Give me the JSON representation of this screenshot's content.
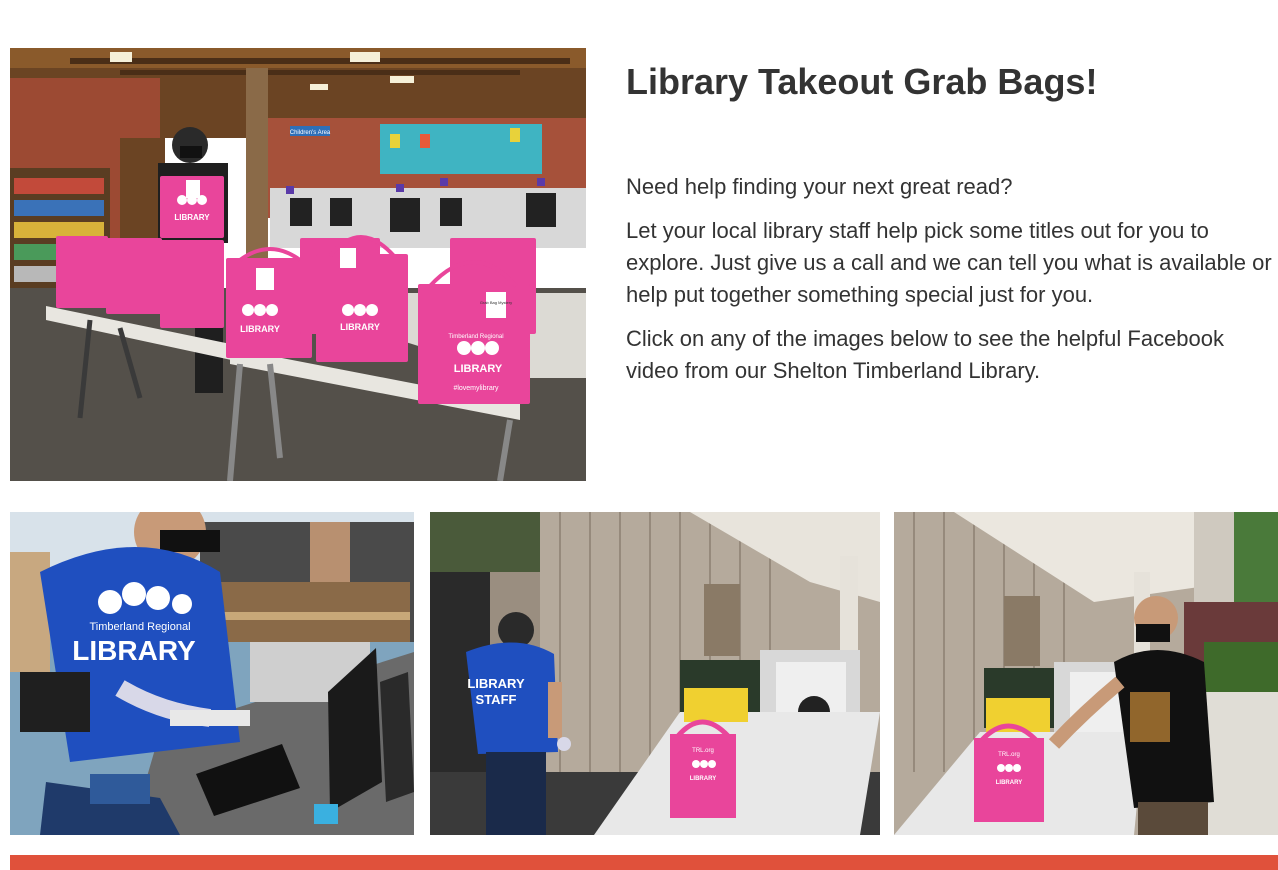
{
  "article": {
    "title": "Library Takeout Grab Bags!",
    "paragraphs": [
      "Need help finding your next great read?",
      "Let your local library staff help pick some titles out for you to explore. Just give us a call and we can tell you what is available or help put together something special just for you.",
      "Click on any  of the images below to see the helpful Facebook video from our Shelton Timberland Library."
    ]
  },
  "hero_photo": {
    "signage": "Children's Area",
    "bag_text": [
      "Timberland Regional",
      "LIBRARY",
      "#lovemylibrary"
    ],
    "tag_text": "Grab Bag Mystery"
  },
  "videos": [
    {
      "shirt_text": [
        "Timberland Regional",
        "LIBRARY"
      ]
    },
    {
      "shirt_text": [
        "LIBRARY",
        "STAFF"
      ],
      "bag_text": [
        "TRL.org",
        "LIBRARY"
      ]
    },
    {
      "bag_text": [
        "TRL.org",
        "LIBRARY"
      ]
    }
  ],
  "colors": {
    "footer_bar": "#e0513b",
    "bag_pink": "#e9459b",
    "text": "#333333"
  }
}
